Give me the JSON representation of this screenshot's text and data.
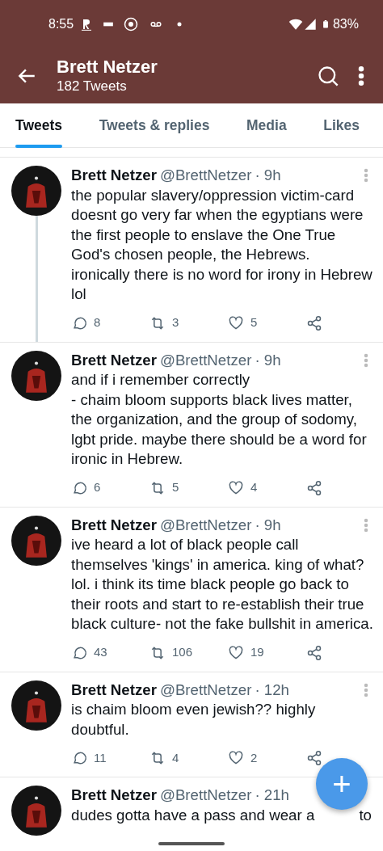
{
  "status_bar": {
    "time": "8:55",
    "battery": "83%"
  },
  "header": {
    "title": "Brett Netzer",
    "subtitle": "182 Tweets"
  },
  "tabs": [
    {
      "label": "Tweets",
      "selected": true
    },
    {
      "label": "Tweets & replies",
      "selected": false
    },
    {
      "label": "Media",
      "selected": false
    },
    {
      "label": "Likes",
      "selected": false
    }
  ],
  "tweets": [
    {
      "name": "Brett Netzer",
      "handle": "@BrettNetzer",
      "time": "· 9h",
      "text": "the popular slavery/oppression victim-card doesnt go very far when the egyptians were the first people to enslave the One True God's chosen people, the Hebrews.\nironically there is no word for irony in Hebrew lol",
      "replies": "8",
      "retweets": "3",
      "likes": "5",
      "thread": true
    },
    {
      "name": "Brett Netzer",
      "handle": "@BrettNetzer",
      "time": "· 9h",
      "text": "and if i remember correctly\n- chaim bloom supports black lives matter, the organization, and the group of sodomy, lgbt pride. maybe there should be a word for ironic in Hebrew.",
      "replies": "6",
      "retweets": "5",
      "likes": "4"
    },
    {
      "name": "Brett Netzer",
      "handle": "@BrettNetzer",
      "time": "· 9h",
      "text": "ive heard a lot of black people call themselves 'kings' in america. king of what? lol. i think its time black people go back to their roots and start to re-establish their true black culture- not the fake bullshit in america.",
      "replies": "43",
      "retweets": "106",
      "likes": "19"
    },
    {
      "name": "Brett Netzer",
      "handle": "@BrettNetzer",
      "time": "· 12h",
      "text": "is chaim bloom even jewish?? highly doubtful.",
      "replies": "11",
      "retweets": "4",
      "likes": "2"
    },
    {
      "name": "Brett Netzer",
      "handle": "@BrettNetzer",
      "time": "· 21h",
      "text_parts": [
        "dudes gotta have a pass and wear a",
        "to"
      ]
    }
  ],
  "fab": {
    "label": "+"
  }
}
